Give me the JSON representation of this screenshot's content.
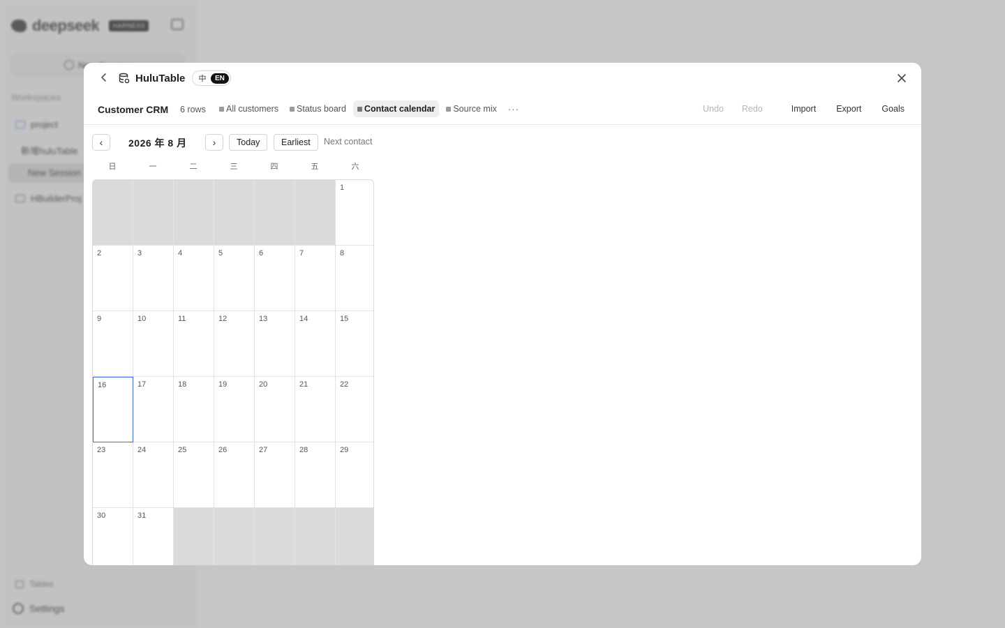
{
  "background": {
    "logo_text": "deepseek",
    "logo_badge": "HARNESS",
    "new_session_label": "New Session",
    "workspaces_label": "Workspaces",
    "project_label": "project",
    "subsession_label": "新增huluTable",
    "active_session_label": "New Session",
    "hbuilder_label": "HBuilderProj",
    "tables_label": "Tables",
    "settings_label": "Settings"
  },
  "modal": {
    "title": "HuluTable",
    "lang": {
      "zh": "中",
      "en": "EN"
    }
  },
  "toolbar": {
    "table_name": "Customer CRM",
    "row_count": "6 rows",
    "tabs": [
      {
        "label": "All customers",
        "active": false
      },
      {
        "label": "Status board",
        "active": false
      },
      {
        "label": "Contact calendar",
        "active": true
      },
      {
        "label": "Source mix",
        "active": false
      }
    ],
    "more": "···",
    "undo": "Undo",
    "redo": "Redo",
    "import": "Import",
    "export": "Export",
    "goals": "Goals"
  },
  "calendar": {
    "prev": "‹",
    "next": "›",
    "month_label": "2026 年 8 月",
    "today_btn": "Today",
    "earliest_btn": "Earliest",
    "next_contact": "Next contact",
    "weekdays": [
      "日",
      "一",
      "二",
      "三",
      "四",
      "五",
      "六"
    ],
    "first_weekday_index": 6,
    "days_in_month": 31,
    "today": 16,
    "rows": 6
  },
  "colors": {
    "accent": "#3b6fe0",
    "out_of_month": "#d9dadc"
  }
}
